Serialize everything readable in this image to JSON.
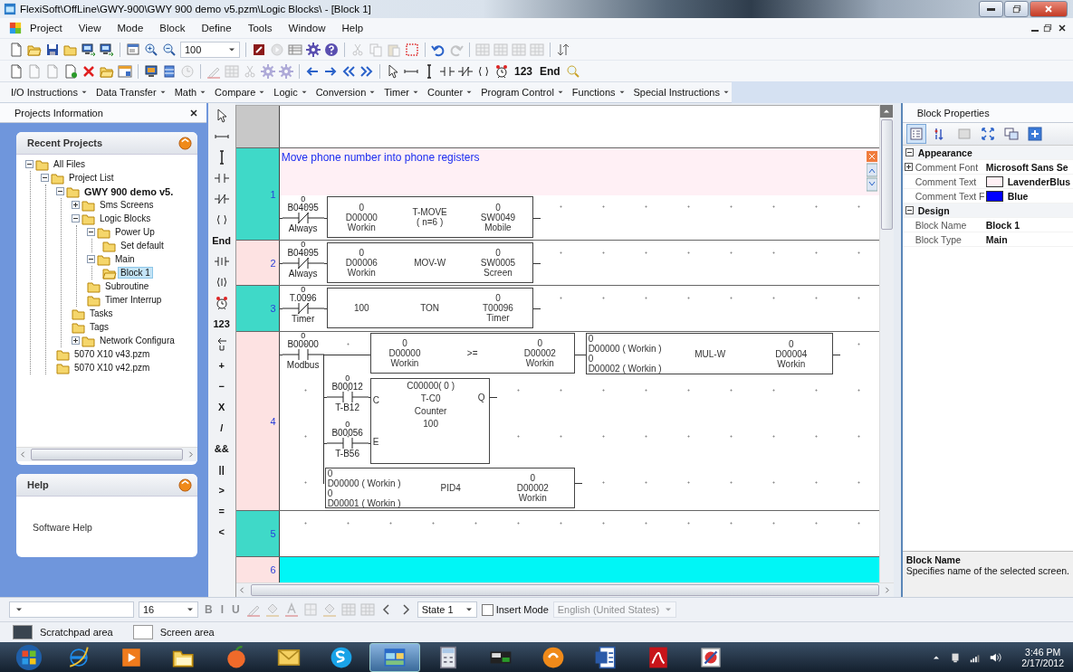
{
  "window": {
    "title": "FlexiSoft\\OffLine\\GWY-900\\GWY 900 demo v5.pzm\\Logic Blocks\\ - [Block 1]"
  },
  "menu": [
    "Project",
    "View",
    "Mode",
    "Block",
    "Define",
    "Tools",
    "Window",
    "Help"
  ],
  "toolbar_1": [
    [
      {
        "kind": "doc",
        "disabled": false
      },
      {
        "kind": "open",
        "disabled": false
      },
      {
        "kind": "save",
        "disabled": false
      },
      {
        "kind": "folder",
        "disabled": false
      },
      {
        "kind": "transfer",
        "disabled": false
      },
      {
        "kind": "transfer",
        "disabled": false
      }
    ],
    [
      {
        "kind": "props",
        "disabled": false
      },
      {
        "kind": "zoom_in",
        "disabled": false
      },
      {
        "kind": "zoom_out",
        "disabled": false
      },
      {
        "kind": "combo",
        "value": "100",
        "disabled": false
      }
    ],
    [
      {
        "kind": "stop",
        "disabled": false
      },
      {
        "kind": "play",
        "disabled": true
      },
      {
        "kind": "table",
        "disabled": false
      },
      {
        "kind": "gear",
        "disabled": false
      },
      {
        "kind": "help",
        "disabled": false
      }
    ],
    [
      {
        "kind": "cut",
        "disabled": true
      },
      {
        "kind": "copy",
        "disabled": true
      },
      {
        "kind": "paste",
        "disabled": true
      },
      {
        "kind": "dots",
        "disabled": false
      }
    ],
    [
      {
        "kind": "undo",
        "disabled": false
      },
      {
        "kind": "redo",
        "disabled": true
      }
    ],
    [
      {
        "kind": "grid",
        "disabled": true
      },
      {
        "kind": "grid",
        "disabled": true
      },
      {
        "kind": "grid",
        "disabled": true
      },
      {
        "kind": "grid",
        "disabled": true
      }
    ],
    [
      {
        "kind": "sort",
        "disabled": false
      }
    ]
  ],
  "toolbar_2": [
    [
      {
        "kind": "doc",
        "disabled": false
      },
      {
        "kind": "doc",
        "disabled": true
      },
      {
        "kind": "doc",
        "disabled": true
      },
      {
        "kind": "doc_green",
        "disabled": false
      },
      {
        "kind": "delete",
        "disabled": false
      },
      {
        "kind": "open",
        "disabled": false
      },
      {
        "kind": "window",
        "disabled": false
      }
    ],
    [
      {
        "kind": "computer",
        "disabled": false
      },
      {
        "kind": "db",
        "disabled": false
      },
      {
        "kind": "clock",
        "disabled": true
      }
    ],
    [
      {
        "kind": "pencil",
        "disabled": true
      },
      {
        "kind": "grid",
        "disabled": true
      },
      {
        "kind": "cut",
        "disabled": true
      },
      {
        "kind": "gear",
        "disabled": true
      },
      {
        "kind": "gear",
        "disabled": true
      }
    ],
    [
      {
        "kind": "arrow_l",
        "disabled": false
      },
      {
        "kind": "arrow_r",
        "disabled": false
      },
      {
        "kind": "dbl_l",
        "disabled": false
      },
      {
        "kind": "dbl_r",
        "disabled": false
      }
    ],
    [
      {
        "kind": "pointer",
        "disabled": false
      },
      {
        "kind": "hline",
        "disabled": false
      },
      {
        "kind": "vline",
        "disabled": false
      },
      {
        "kind": "contact_no",
        "disabled": false
      },
      {
        "kind": "contact_nc",
        "disabled": false
      },
      {
        "kind": "coil",
        "disabled": false
      },
      {
        "kind": "alarm",
        "disabled": false
      },
      {
        "kind": "text",
        "label": "123",
        "disabled": false
      },
      {
        "kind": "text",
        "label": "End",
        "disabled": false
      },
      {
        "kind": "search",
        "disabled": false
      }
    ]
  ],
  "instruction_menu": [
    "I/O Instructions",
    "Data Transfer",
    "Math",
    "Compare",
    "Logic",
    "Conversion",
    "Timer",
    "Counter",
    "Program Control",
    "Functions",
    "Special Instructions"
  ],
  "projects_panel": {
    "title": "Projects Information",
    "recent": {
      "title": "Recent Projects",
      "tree": [
        {
          "label": "All Files",
          "kind": "folder",
          "expanded": true,
          "selected": false,
          "children": [
            {
              "label": "Project List",
              "kind": "folder",
              "expanded": true,
              "selected": false,
              "children": [
                {
                  "label": "GWY 900 demo v5.",
                  "kind": "project",
                  "expanded": true,
                  "selected": false,
                  "children": [
                    {
                      "label": "Sms Screens",
                      "kind": "folder",
                      "expanded": false,
                      "selected": false
                    },
                    {
                      "label": "Logic Blocks",
                      "kind": "folder",
                      "expanded": true,
                      "selected": false,
                      "children": [
                        {
                          "label": "Power Up",
                          "kind": "folder",
                          "expanded": true,
                          "selected": false,
                          "children": [
                            {
                              "label": "Set default",
                              "kind": "folder",
                              "selected": false
                            }
                          ]
                        },
                        {
                          "label": "Main",
                          "kind": "folder",
                          "expanded": true,
                          "selected": false,
                          "children": [
                            {
                              "label": "Block 1",
                              "kind": "folder",
                              "selected": true
                            }
                          ]
                        },
                        {
                          "label": "Subroutine",
                          "kind": "folder",
                          "selected": false
                        },
                        {
                          "label": "Timer Interrup",
                          "kind": "folder",
                          "selected": false
                        }
                      ]
                    },
                    {
                      "label": "Tasks",
                      "kind": "folder",
                      "selected": false
                    },
                    {
                      "label": "Tags",
                      "kind": "folder",
                      "selected": false
                    },
                    {
                      "label": "Network Configura",
                      "kind": "folder",
                      "expanded": false,
                      "selected": false
                    }
                  ]
                },
                {
                  "label": "5070 X10 v43.pzm",
                  "kind": "folder",
                  "selected": false
                },
                {
                  "label": "5070 X10 v42.pzm",
                  "kind": "folder",
                  "selected": false
                }
              ]
            }
          ]
        }
      ]
    },
    "help": {
      "title": "Help",
      "text": "Software Help"
    }
  },
  "tool_strip": [
    {
      "kind": "pointer"
    },
    {
      "kind": "hline"
    },
    {
      "kind": "vline"
    },
    {
      "kind": "contact_no"
    },
    {
      "kind": "contact_nc"
    },
    {
      "kind": "coil"
    },
    {
      "kind": "text",
      "label": "End"
    },
    {
      "kind": "contact_i"
    },
    {
      "kind": "coil_i"
    },
    {
      "kind": "alarm"
    },
    {
      "kind": "text",
      "label": "123"
    },
    {
      "kind": "return"
    },
    {
      "kind": "text",
      "label": "+"
    },
    {
      "kind": "text",
      "label": "−"
    },
    {
      "kind": "text",
      "label": "X"
    },
    {
      "kind": "text",
      "label": "/"
    },
    {
      "kind": "text",
      "label": "&&"
    },
    {
      "kind": "text",
      "label": "||"
    },
    {
      "kind": "text",
      "label": ">"
    },
    {
      "kind": "text",
      "label": "="
    },
    {
      "kind": "text",
      "label": "<"
    }
  ],
  "ladder": {
    "rungs": [
      {
        "number": "1",
        "color": "#3fd9c8",
        "selected": false,
        "comment": "Move phone number into phone registers",
        "elements": [
          {
            "kind": "nc_contact",
            "value": "0",
            "address": "B04095",
            "tag": "Always"
          },
          {
            "kind": "box",
            "columns": [
              [
                "0",
                "D00000",
                "Workin"
              ],
              [
                "T-MOVE",
                "( n=6 )"
              ],
              [
                "0",
                "SW0049",
                "Mobile"
              ]
            ]
          }
        ]
      },
      {
        "number": "2",
        "color": "#fde2e2",
        "selected": false,
        "elements": [
          {
            "kind": "nc_contact",
            "value": "0",
            "address": "B04095",
            "tag": "Always"
          },
          {
            "kind": "box",
            "columns": [
              [
                "0",
                "D00006",
                "Workin"
              ],
              [
                "MOV-W"
              ],
              [
                "0",
                "SW0005",
                "Screen"
              ]
            ]
          }
        ]
      },
      {
        "number": "3",
        "color": "#3fd9c8",
        "selected": false,
        "elements": [
          {
            "kind": "nc_contact",
            "value": "0",
            "address": "T.0096",
            "tag": "Timer"
          },
          {
            "kind": "box",
            "columns": [
              [
                "100"
              ],
              [
                "TON"
              ],
              [
                "0",
                "T00096",
                "Timer"
              ]
            ]
          }
        ]
      },
      {
        "number": "4",
        "color": "#fde2e2",
        "selected": false,
        "elements": [
          {
            "kind": "no_contact",
            "value": "0",
            "address": "B00000",
            "tag": "Modbus"
          },
          {
            "kind": "box",
            "columns": [
              [
                "0",
                "D00000",
                "Workin"
              ],
              [
                ">="
              ],
              [
                "0",
                "D00002",
                "Workin"
              ]
            ]
          },
          {
            "kind": "box",
            "columns": [
              [
                "0",
                "D00000 ( Workin )",
                "0",
                "D00002 ( Workin )"
              ],
              [
                "MUL-W"
              ],
              [
                "0",
                "D00004",
                "Workin"
              ]
            ]
          },
          {
            "kind": "no_contact",
            "value": "0",
            "address": "B00012",
            "tag": "T-B12"
          },
          {
            "kind": "no_contact",
            "value": "0",
            "address": "B00056",
            "tag": "T-B56"
          },
          {
            "kind": "function_block",
            "inputs": [
              "C",
              "E"
            ],
            "output": "Q",
            "lines": [
              "C00000( 0 )",
              "T-C0",
              "Counter",
              "100"
            ]
          },
          {
            "kind": "box",
            "columns": [
              [
                "0",
                "D00000 ( Workin )",
                "0",
                "D00001 ( Workin )"
              ],
              [
                "PID4"
              ],
              [
                "0",
                "D00002",
                "Workin"
              ]
            ]
          }
        ]
      },
      {
        "number": "5",
        "color": "#3fd9c8",
        "selected": false
      },
      {
        "number": "6",
        "color": "#fde2e2",
        "selected": true
      }
    ]
  },
  "block_properties": {
    "title": "Block Properties",
    "tools": [
      {
        "kind": "categorized",
        "selected": true
      },
      {
        "kind": "az_sort",
        "selected": false
      },
      {
        "kind": "pages",
        "selected": false
      },
      {
        "kind": "expand_all",
        "selected": false
      },
      {
        "kind": "props2",
        "selected": false
      },
      {
        "kind": "plus_box",
        "selected": false
      }
    ],
    "categories": [
      {
        "name": "Appearance",
        "expanded": true,
        "properties": [
          {
            "name": "Comment Font",
            "value": "Microsoft Sans Se",
            "expanded": false
          },
          {
            "name": "Comment Text",
            "value": "LavenderBlus",
            "color": "#fff0f5"
          },
          {
            "name": "Comment Text F",
            "value": "Blue",
            "color": "#0000ff"
          }
        ]
      },
      {
        "name": "Design",
        "expanded": true,
        "properties": [
          {
            "name": "Block Name",
            "value": "Block 1"
          },
          {
            "name": "Block Type",
            "value": "Main"
          }
        ]
      }
    ],
    "description": {
      "title": "Block Name",
      "text": "Specifies name of the selected screen."
    }
  },
  "format_bar": [
    {
      "kind": "combo",
      "disabled": false
    },
    {
      "kind": "combo",
      "value": "16",
      "disabled": false
    },
    {
      "kind": "text",
      "label": "B",
      "disabled": true
    },
    {
      "kind": "text",
      "label": "I",
      "disabled": true
    },
    {
      "kind": "text",
      "label": "U",
      "disabled": true
    },
    {
      "kind": "pencil",
      "disabled": true
    },
    {
      "kind": "bucket",
      "disabled": true
    },
    {
      "kind": "font_color",
      "disabled": true
    },
    {
      "kind": "border",
      "disabled": true
    },
    {
      "kind": "bucket",
      "disabled": true
    },
    {
      "kind": "grid",
      "disabled": true
    },
    {
      "kind": "grid",
      "disabled": true
    },
    {
      "kind": "chev_l",
      "disabled": false
    },
    {
      "kind": "chev_r",
      "disabled": false
    },
    {
      "kind": "combo",
      "value": "State 1",
      "disabled": false
    },
    {
      "kind": "checkbox",
      "label": "Insert Mode",
      "checked": false,
      "disabled": false
    },
    {
      "kind": "combo",
      "value": "English (United States)",
      "disabled": true
    }
  ],
  "status_bar": [
    {
      "label": "Scratchpad area",
      "color": "#3a4550"
    },
    {
      "label": "Screen area",
      "color": "#ffffff"
    }
  ],
  "taskbar": {
    "apps": [
      {
        "kind": "ie",
        "selected": false
      },
      {
        "kind": "media",
        "selected": false
      },
      {
        "kind": "explorer",
        "selected": false
      },
      {
        "kind": "peach",
        "selected": false
      },
      {
        "kind": "mail",
        "selected": false
      },
      {
        "kind": "skype",
        "selected": false
      },
      {
        "kind": "appwin",
        "selected": true
      },
      {
        "kind": "calc",
        "selected": false
      },
      {
        "kind": "techapp",
        "selected": false
      },
      {
        "kind": "disc",
        "selected": false
      },
      {
        "kind": "word",
        "selected": false
      },
      {
        "kind": "pdf",
        "selected": false
      },
      {
        "kind": "mail2",
        "selected": false
      }
    ],
    "time": "3:46 PM",
    "date": "2/17/2012"
  }
}
